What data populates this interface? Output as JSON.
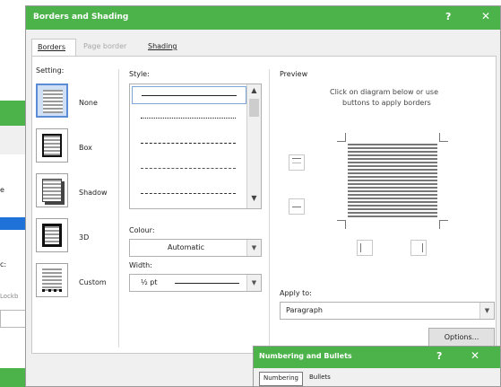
{
  "background_window": {
    "label_e": "e",
    "label_c": "c:",
    "label_field": "Lockb"
  },
  "dialog": {
    "title": "Borders and Shading",
    "help": "?",
    "close": "✕",
    "tabs": [
      {
        "label": "Borders"
      },
      {
        "label": "Page border"
      },
      {
        "label": "Shading"
      }
    ],
    "setting": {
      "label": "Setting:",
      "items": [
        {
          "label": "None"
        },
        {
          "label": "Box"
        },
        {
          "label": "Shadow"
        },
        {
          "label": "3D"
        },
        {
          "label": "Custom"
        }
      ]
    },
    "style": {
      "label": "Style:",
      "scroll_up": "▲",
      "scroll_down": "▼"
    },
    "colour": {
      "label": "Colour:",
      "value": "Automatic",
      "arrow": "▼"
    },
    "width": {
      "label": "Width:",
      "value": "½ pt",
      "arrow": "▼"
    },
    "preview": {
      "label": "Preview",
      "instructions_line1": "Click on diagram below or use",
      "instructions_line2": "buttons to apply borders"
    },
    "apply_to": {
      "label": "Apply to:",
      "value": "Paragraph",
      "arrow": "▼"
    },
    "options_button": "Options..."
  },
  "numbering_dialog": {
    "title": "Numbering and Bullets",
    "help": "?",
    "close": "✕",
    "tabs": [
      {
        "label": "Numbering"
      },
      {
        "label": "Bullets"
      }
    ]
  }
}
